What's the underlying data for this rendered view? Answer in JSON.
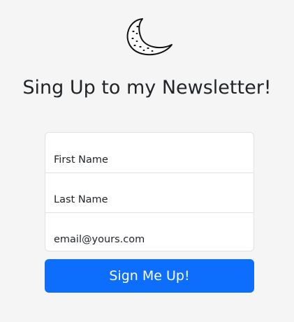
{
  "logo": {
    "icon": "crescent-moon-icon"
  },
  "form": {
    "heading": "Sing Up to my Newsletter!",
    "fields": [
      {
        "name": "first_name",
        "placeholder": "First Name",
        "value": ""
      },
      {
        "name": "last_name",
        "placeholder": "Last Name",
        "value": ""
      },
      {
        "name": "email",
        "placeholder": "email@yours.com",
        "value": ""
      }
    ],
    "submit_label": "Sign Me Up!"
  },
  "colors": {
    "background": "#f5f5f5",
    "primary": "#0d6efd",
    "text": "#212529",
    "border": "#dee2e6"
  }
}
